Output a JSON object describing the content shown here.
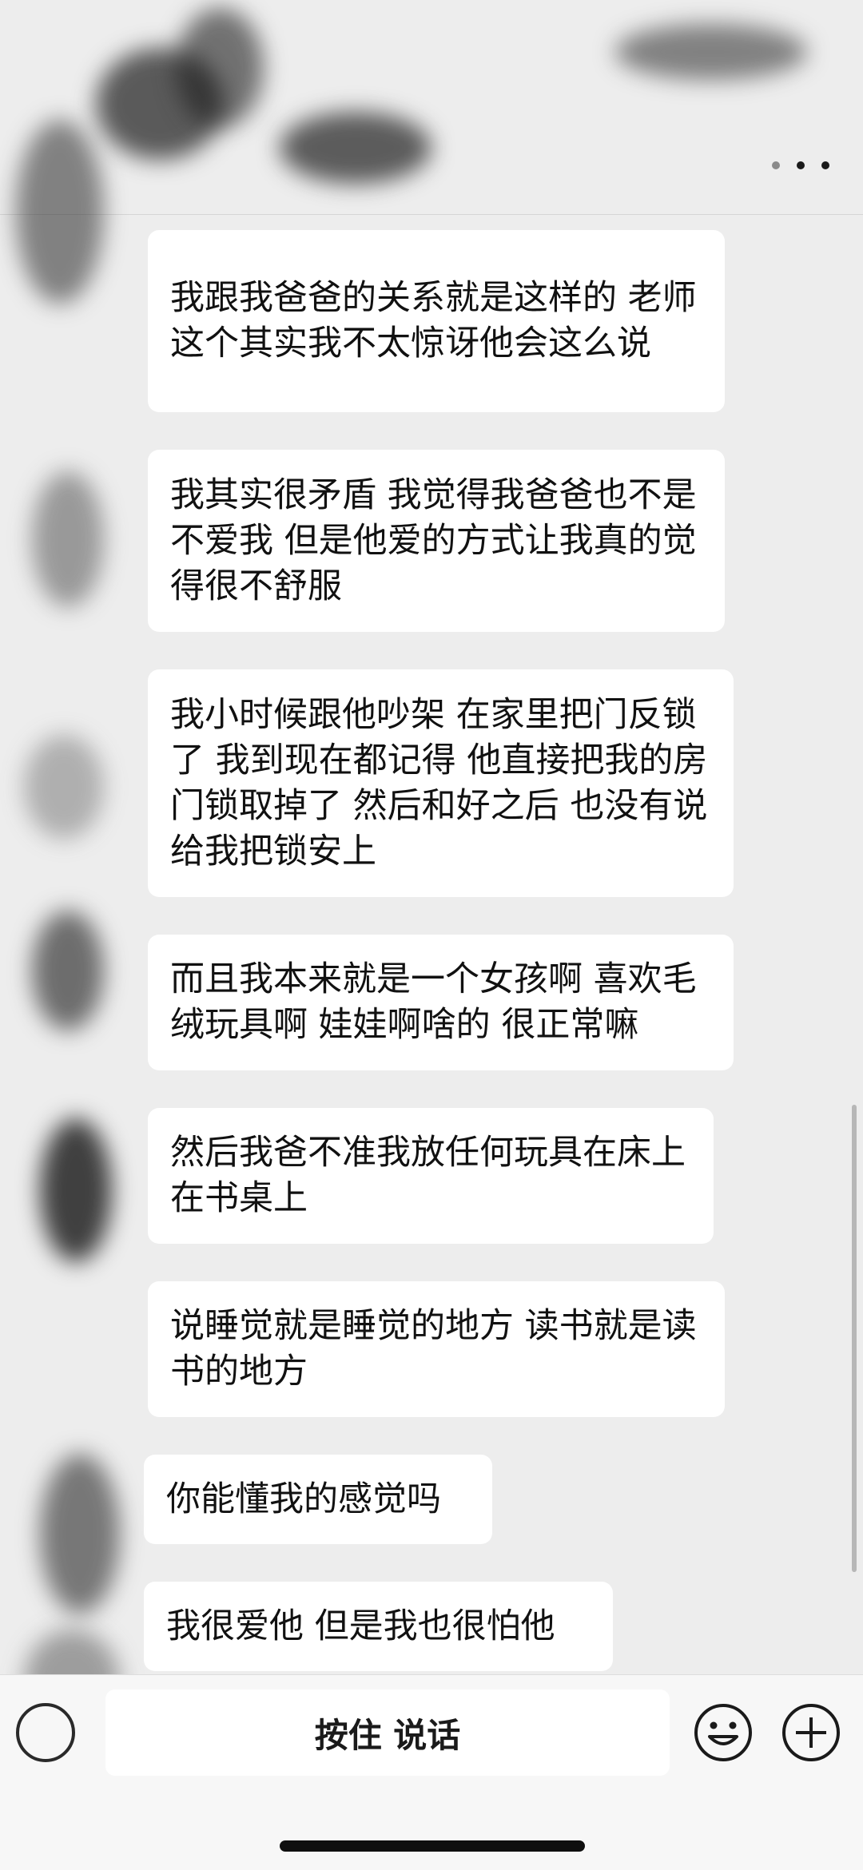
{
  "messages": [
    {
      "text": "我跟我爸爸的关系就是这样的 老师 这个其实我不太惊讶他会这么说"
    },
    {
      "text": "我其实很矛盾 我觉得我爸爸也不是不爱我 但是他爱的方式让我真的觉得很不舒服"
    },
    {
      "text": "我小时候跟他吵架 在家里把门反锁了 我到现在都记得 他直接把我的房门锁取掉了 然后和好之后 也没有说给我把锁安上"
    },
    {
      "text": "而且我本来就是一个女孩啊 喜欢毛绒玩具啊 娃娃啊啥的 很正常嘛"
    },
    {
      "text": "然后我爸不准我放任何玩具在床上 在书桌上"
    },
    {
      "text": "说睡觉就是睡觉的地方 读书就是读书的地方"
    },
    {
      "text": "你能懂我的感觉吗"
    },
    {
      "text": "我很爱他 但是我也很怕他"
    }
  ],
  "input_bar": {
    "hold_to_talk_label": "按住 说话",
    "voice_icon": "voice-icon",
    "emoji_icon": "smiley-icon",
    "plus_icon": "plus-icon"
  },
  "top_bar": {
    "more_icon": "more-icon"
  },
  "colors": {
    "background": "#ededed",
    "bubble": "#ffffff",
    "text": "#111111",
    "input_bar": "#f7f7f7"
  }
}
